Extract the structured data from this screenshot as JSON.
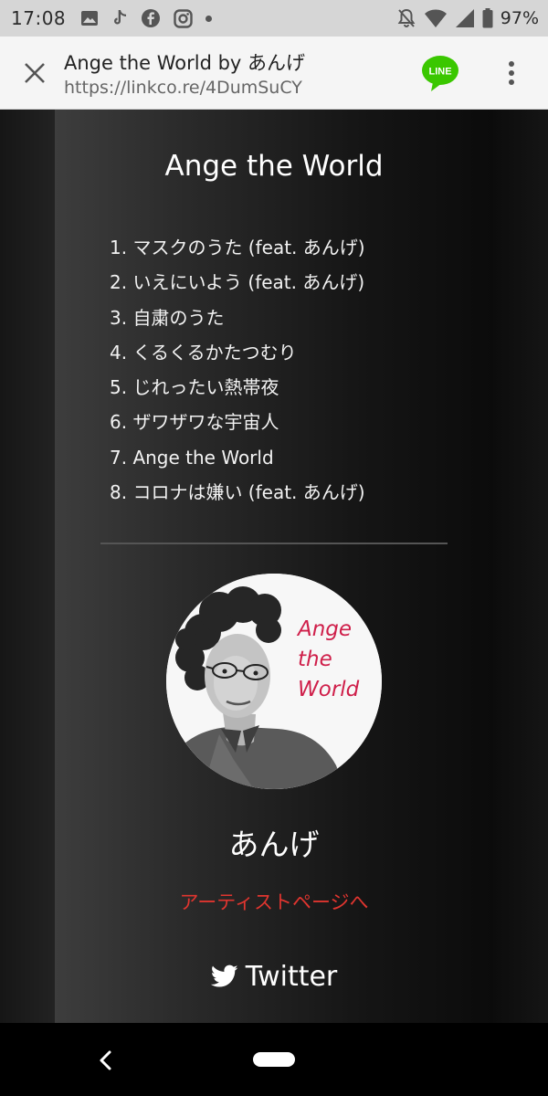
{
  "status_bar": {
    "time": "17:08",
    "battery_percent": "97%",
    "left_icons": [
      "gallery-icon",
      "tiktok-icon",
      "facebook-icon",
      "instagram-icon",
      "dot-icon"
    ],
    "right_icons": [
      "mute-icon",
      "wifi-icon",
      "signal-icon",
      "battery-icon"
    ]
  },
  "browser": {
    "title": "Ange the World by あんげ",
    "url": "https://linkco.re/4DumSuCY",
    "share_label": "LINE"
  },
  "album": {
    "title": "Ange the World",
    "tracks": [
      "1. マスクのうた (feat. あんげ)",
      "2. いえにいよう (feat. あんげ)",
      "3. 自粛のうた",
      "4. くるくるかたつむり",
      "5. じれったい熱帯夜",
      "6. ザワザワな宇宙人",
      "7. Ange the World",
      "8. コロナは嫌い (feat. あんげ)"
    ]
  },
  "artist": {
    "avatar_text": [
      "Ange",
      "the",
      "World"
    ],
    "name": "あんげ",
    "page_link": "アーティストページへ",
    "twitter_label": "Twitter"
  },
  "colors": {
    "accent_red": "#e0352f",
    "line_green": "#3ac700",
    "avatar_text": "#cf1f4a"
  }
}
